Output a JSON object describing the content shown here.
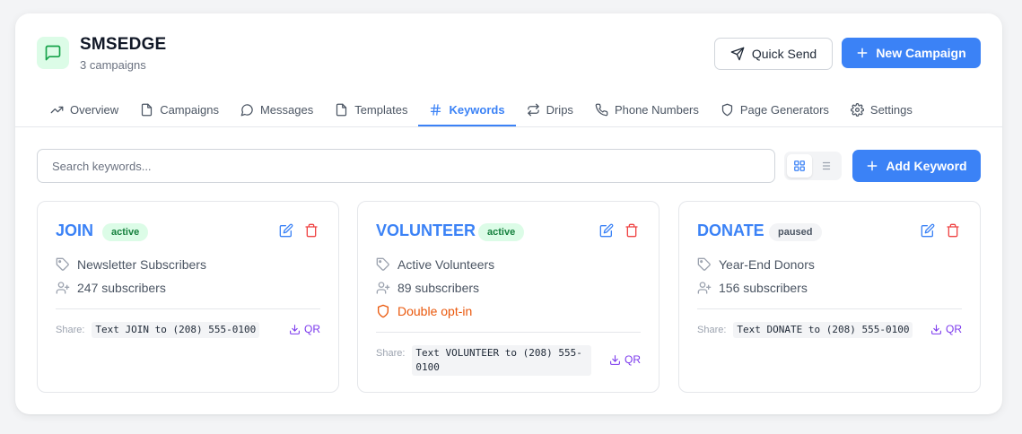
{
  "app": {
    "title": "SMSEDGE",
    "subtitle": "3 campaigns",
    "quick_send_label": "Quick Send",
    "new_campaign_label": "New Campaign",
    "brand_color": "#22c55e",
    "accent_color": "#3b82f6"
  },
  "tabs": [
    {
      "label": "Overview",
      "icon": "trending-up-icon"
    },
    {
      "label": "Campaigns",
      "icon": "file-icon"
    },
    {
      "label": "Messages",
      "icon": "chat-icon"
    },
    {
      "label": "Templates",
      "icon": "file-icon"
    },
    {
      "label": "Keywords",
      "icon": "hash-icon",
      "active": true
    },
    {
      "label": "Drips",
      "icon": "repeat-icon"
    },
    {
      "label": "Phone Numbers",
      "icon": "phone-icon"
    },
    {
      "label": "Page Generators",
      "icon": "shield-icon"
    },
    {
      "label": "Settings",
      "icon": "gear-icon"
    }
  ],
  "toolbar": {
    "search_placeholder": "Search keywords...",
    "add_keyword_label": "Add Keyword",
    "view_mode": "grid"
  },
  "keywords": [
    {
      "keyword": "JOIN",
      "status": "active",
      "list": "Newsletter Subscribers",
      "subscribers": "247 subscribers",
      "share_label": "Share:",
      "share_text": "Text JOIN to (208) 555-0100",
      "qr_label": "QR"
    },
    {
      "keyword": "VOLUNTEER",
      "status": "active",
      "list": "Active Volunteers",
      "subscribers": "89 subscribers",
      "double_opt_in": "Double opt-in",
      "share_label": "Share:",
      "share_text_line1": "Text VOLUNTEER to (208) 555-",
      "share_text_line2": "0100",
      "qr_label": "QR"
    },
    {
      "keyword": "DONATE",
      "status": "paused",
      "list": "Year-End Donors",
      "subscribers": "156 subscribers",
      "share_label": "Share:",
      "share_text": "Text DONATE to (208) 555-0100",
      "qr_label": "QR"
    }
  ]
}
